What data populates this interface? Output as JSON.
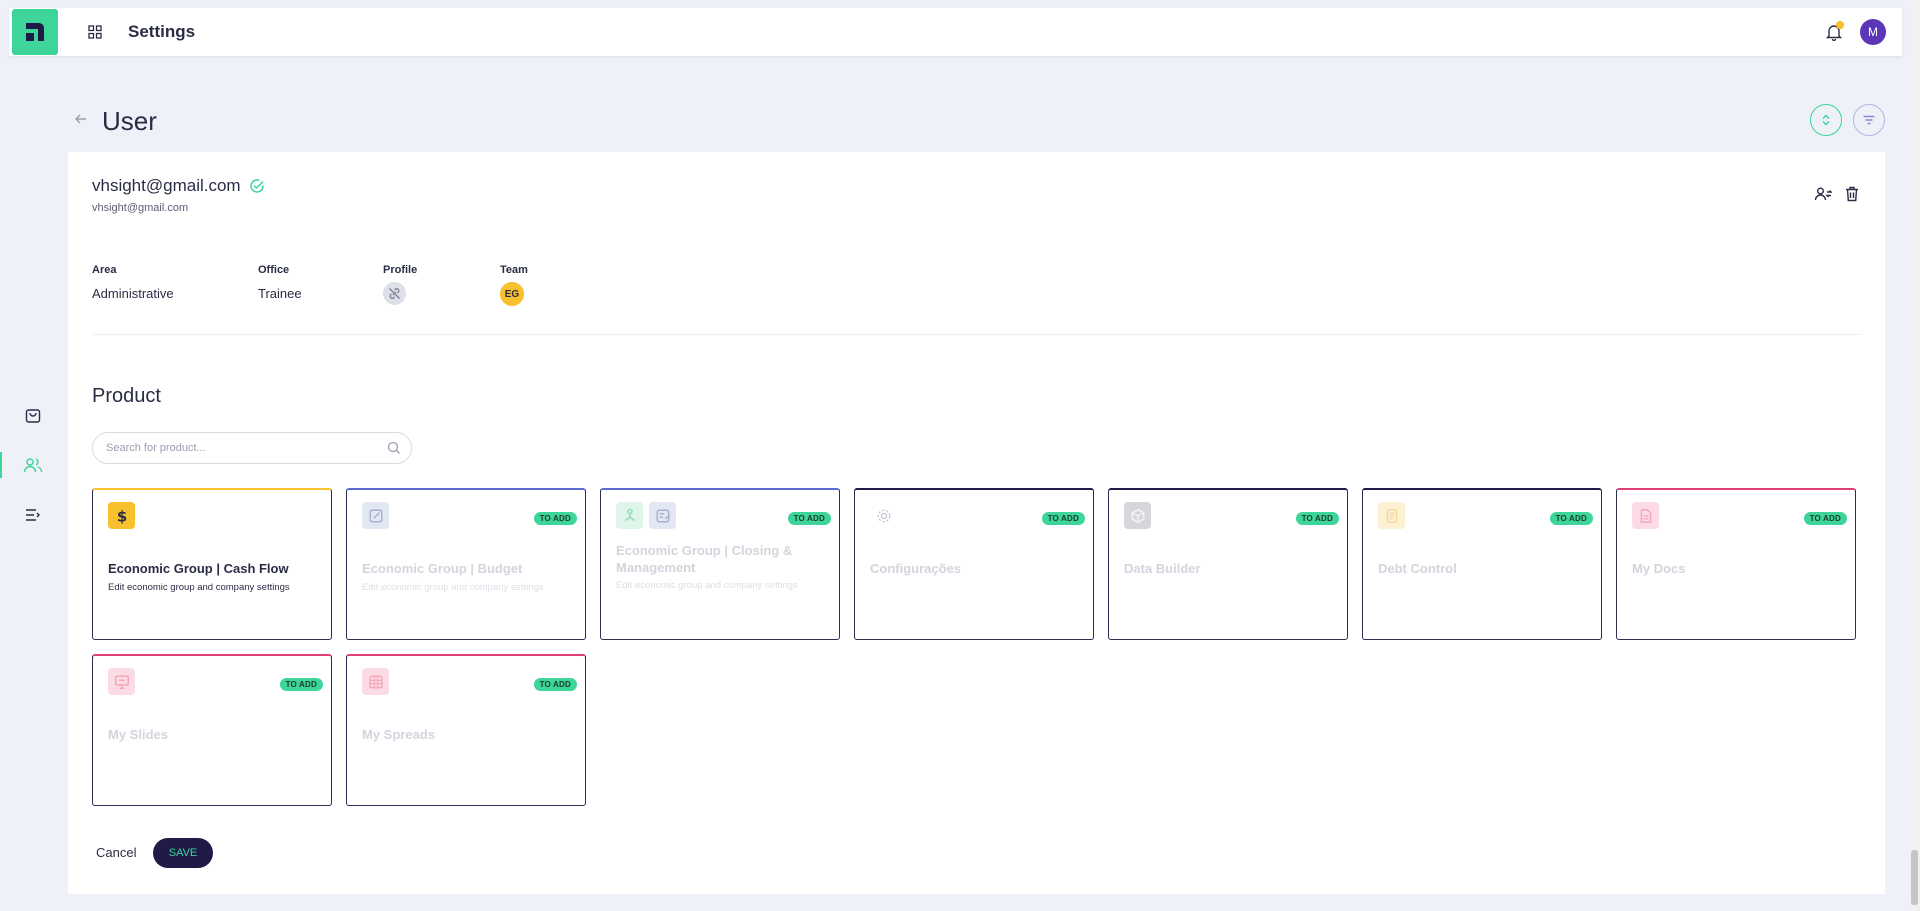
{
  "header": {
    "title": "Settings",
    "logo_icon": "app-logo-icon",
    "apps_icon": "grid-icon",
    "notification_icon": "bell-icon",
    "user_avatar": "M"
  },
  "sidebar": {
    "items": [
      {
        "name": "products",
        "icon": "shopping-bag-icon"
      },
      {
        "name": "users",
        "icon": "users-icon",
        "active": true
      },
      {
        "name": "menu",
        "icon": "collapse-menu-icon"
      }
    ]
  },
  "page": {
    "title": "User"
  },
  "user": {
    "email": "vhsight@gmail.com",
    "email_secondary": "vhsight@gmail.com",
    "verified_icon": "check-circle-icon",
    "area_label": "Area",
    "area": "Administrative",
    "office_label": "Office",
    "office": "Trainee",
    "profile_label": "Profile",
    "profile_icon": "unlink-icon",
    "team_label": "Team",
    "team": "EG"
  },
  "product": {
    "section_title": "Product",
    "search_placeholder": "Search for product...",
    "badge_label": "TO ADD",
    "tiles": [
      {
        "name": "Economic Group | Cash Flow",
        "desc": "Edit economic group and company settings",
        "active": true,
        "badge": false,
        "icons": [
          {
            "icon": "dollar-icon",
            "bg": "#f7c02c",
            "fg": "#2a2d45"
          }
        ]
      },
      {
        "name": "Economic Group | Budget",
        "desc": "Edit economic group and company settings",
        "active": false,
        "badge": true,
        "icons": [
          {
            "icon": "edit-icon",
            "bg": "#e3e7f3",
            "fg": "#a9b1cd"
          }
        ]
      },
      {
        "name": "Economic Group | Closing & Management",
        "desc": "Edit economic group and company settings",
        "active": false,
        "badge": true,
        "icons": [
          {
            "icon": "org-chart-icon",
            "bg": "#dff5ea",
            "fg": "#8fdcb5"
          },
          {
            "icon": "checklist-icon",
            "bg": "#e3e7f3",
            "fg": "#a9b1cd"
          }
        ]
      },
      {
        "name": "Configurações",
        "desc": "",
        "active": false,
        "badge": true,
        "icons": [
          {
            "icon": "gear-icon",
            "bg": "transparent",
            "fg": "#c4c8d4"
          }
        ]
      },
      {
        "name": "Data Builder",
        "desc": "",
        "active": false,
        "badge": true,
        "icons": [
          {
            "icon": "cube-icon",
            "bg": "#d6d7dc",
            "fg": "#f3f4f7"
          }
        ]
      },
      {
        "name": "Debt Control",
        "desc": "",
        "active": false,
        "badge": true,
        "icons": [
          {
            "icon": "ledger-icon",
            "bg": "#fdf1d4",
            "fg": "#f2d597"
          }
        ]
      },
      {
        "name": "My Docs",
        "desc": "",
        "active": false,
        "badge": true,
        "icons": [
          {
            "icon": "document-icon",
            "bg": "#fbdbe4",
            "fg": "#f4a6bd"
          }
        ]
      },
      {
        "name": "My Slides",
        "desc": "",
        "active": false,
        "badge": true,
        "icons": [
          {
            "icon": "presentation-icon",
            "bg": "#fbdbe4",
            "fg": "#f4a6bd"
          }
        ]
      },
      {
        "name": "My Spreads",
        "desc": "",
        "active": false,
        "badge": true,
        "icons": [
          {
            "icon": "spreadsheet-icon",
            "bg": "#fbdbe4",
            "fg": "#f4a6bd"
          }
        ]
      }
    ]
  },
  "actions": {
    "cancel_label": "Cancel",
    "save_label": "SAVE"
  },
  "colors": {
    "accent": "#3dd599",
    "primary_dark": "#1f1a48",
    "avatar": "#5b36b8",
    "team_badge": "#f7c02c",
    "cash_flow_accent": "#f7c02c",
    "budget_accent": "#5b6cd0",
    "docs_accent": "#e0407a"
  }
}
